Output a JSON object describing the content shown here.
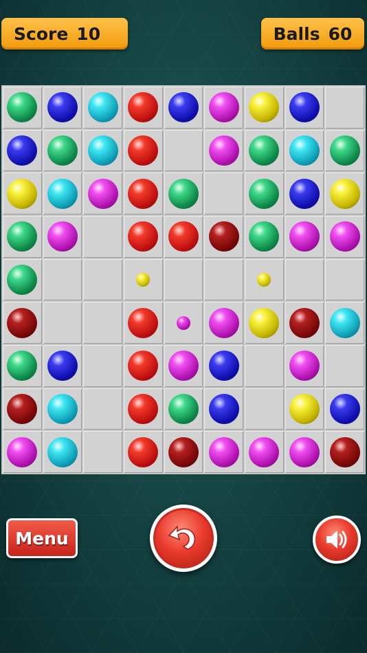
{
  "header": {
    "score_label": "Score",
    "score_value": "10",
    "balls_label": "Balls",
    "balls_value": "60"
  },
  "board": {
    "rows": 9,
    "cols": 9,
    "cells": [
      [
        "green",
        "blue",
        "cyan",
        "red",
        "blue",
        "magenta",
        "yellow",
        "blue",
        ""
      ],
      [
        "blue",
        "green",
        "cyan",
        "red",
        "",
        "magenta",
        "green",
        "cyan",
        "green"
      ],
      [
        "yellow",
        "cyan",
        "magenta",
        "red",
        "green",
        "",
        "green",
        "blue",
        "yellow"
      ],
      [
        "green",
        "magenta",
        "",
        "red",
        "red",
        "darkred",
        "green",
        "magenta",
        "magenta"
      ],
      [
        "green",
        "",
        "",
        "yellow-small",
        "",
        "",
        "yellow-small",
        "",
        ""
      ],
      [
        "darkred",
        "",
        "",
        "red",
        "magenta-small",
        "magenta",
        "yellow",
        "darkred",
        "cyan"
      ],
      [
        "green",
        "blue",
        "",
        "red",
        "magenta",
        "blue",
        "",
        "magenta",
        ""
      ],
      [
        "darkred",
        "cyan",
        "",
        "red",
        "green",
        "blue",
        "",
        "yellow",
        "blue"
      ],
      [
        "magenta",
        "cyan",
        "",
        "red",
        "darkred",
        "magenta",
        "magenta",
        "magenta",
        "darkred"
      ]
    ]
  },
  "controls": {
    "menu_label": "Menu",
    "undo_icon": "undo-arrow-icon",
    "sound_icon": "speaker-icon"
  },
  "colors": {
    "pill": "#f5a623",
    "button_red": "#e0342a",
    "board_bg": "#d2d2d2"
  }
}
